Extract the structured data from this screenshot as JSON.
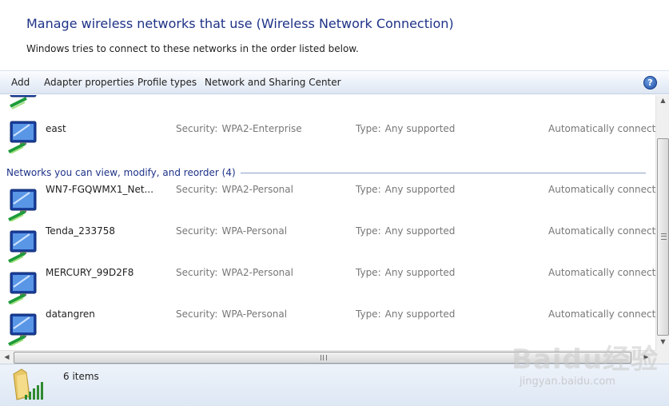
{
  "header": {
    "title": "Manage wireless networks that use (Wireless Network Connection)",
    "subtitle": "Windows tries to connect to these networks in the order listed below."
  },
  "toolbar": {
    "add": "Add",
    "adapter_properties": "Adapter properties",
    "profile_types": "Profile types",
    "network_sharing_center": "Network and Sharing Center",
    "help": "?"
  },
  "list": {
    "security_label": "Security:",
    "type_label": "Type:",
    "top_networks": [
      {
        "name": "east",
        "security": "WPA2-Enterprise",
        "type": "Any supported",
        "mode": "Automatically connect"
      }
    ],
    "group_label": "Networks you can view, modify, and reorder (4)",
    "networks": [
      {
        "name": "WN7-FGQWMX1_Net...",
        "security": "WPA2-Personal",
        "type": "Any supported",
        "mode": "Automatically connect"
      },
      {
        "name": "Tenda_233758",
        "security": "WPA-Personal",
        "type": "Any supported",
        "mode": "Automatically connect"
      },
      {
        "name": "MERCURY_99D2F8",
        "security": "WPA2-Personal",
        "type": "Any supported",
        "mode": "Automatically connect"
      },
      {
        "name": "datangren",
        "security": "WPA-Personal",
        "type": "Any supported",
        "mode": "Automatically connect"
      }
    ]
  },
  "status": {
    "count": "6 items"
  },
  "watermark": {
    "text": "Baidu经验",
    "url": "jingyan.baidu.com"
  },
  "colors": {
    "title": "#1e3287",
    "group_line": "#8aa0c8",
    "toolbar_bg": "#e9eff8",
    "detail_text": "#777777"
  }
}
